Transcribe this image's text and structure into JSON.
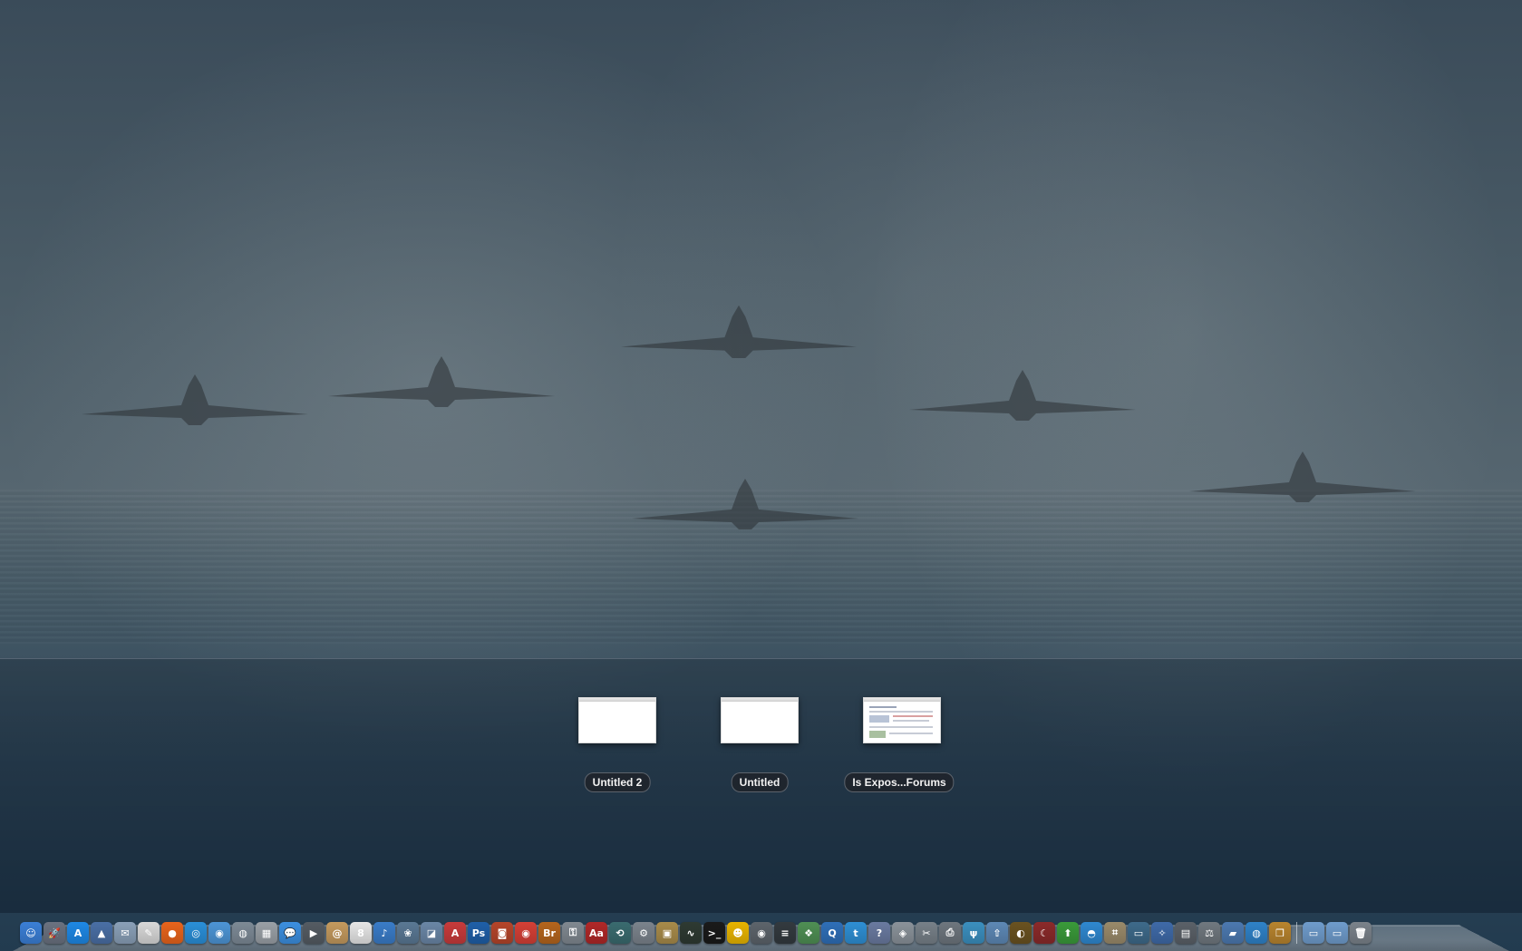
{
  "expose": {
    "windows": [
      {
        "title": "Untitled 2",
        "thumbnail": "blank-document"
      },
      {
        "title": "Untitled",
        "thumbnail": "blank-document"
      },
      {
        "title": "Is Expos...Forums",
        "thumbnail": "web-forum-page"
      }
    ]
  },
  "dock": {
    "apps": [
      {
        "icon": "finder-icon",
        "glyph": "☺",
        "color": "#3b7fd6"
      },
      {
        "icon": "launchpad-icon",
        "glyph": "🚀",
        "color": "#6b7280"
      },
      {
        "icon": "app-store-icon",
        "glyph": "A",
        "color": "#1e88e5"
      },
      {
        "icon": "preview-icon",
        "glyph": "▲",
        "color": "#4a6fa5"
      },
      {
        "icon": "mail-icon",
        "glyph": "✉",
        "color": "#8aa0b8"
      },
      {
        "icon": "textedit-icon",
        "glyph": "✎",
        "color": "#d8d8d8"
      },
      {
        "icon": "firefox-icon",
        "glyph": "●",
        "color": "#e8641c"
      },
      {
        "icon": "safari-icon",
        "glyph": "◎",
        "color": "#2a8fd8"
      },
      {
        "icon": "chrome-like-icon",
        "glyph": "◉",
        "color": "#4d95d6"
      },
      {
        "icon": "network-utility-icon",
        "glyph": "◍",
        "color": "#7d8a96"
      },
      {
        "icon": "calculator-icon",
        "glyph": "▦",
        "color": "#9aa0a6"
      },
      {
        "icon": "ichat-icon",
        "glyph": "💬",
        "color": "#3c8fe0"
      },
      {
        "icon": "facetime-icon",
        "glyph": "▶",
        "color": "#555c63"
      },
      {
        "icon": "address-book-icon",
        "glyph": "@",
        "color": "#c49a5e"
      },
      {
        "icon": "ical-icon",
        "glyph": "8",
        "color": "#e6e6e6"
      },
      {
        "icon": "itunes-icon",
        "glyph": "♪",
        "color": "#3a7cc8"
      },
      {
        "icon": "iphoto-icon",
        "glyph": "❀",
        "color": "#5a7894"
      },
      {
        "icon": "image-capture-icon",
        "glyph": "◪",
        "color": "#6a86a6"
      },
      {
        "icon": "acrobat-icon",
        "glyph": "A",
        "color": "#c83b3b"
      },
      {
        "icon": "photoshop-icon",
        "glyph": "Ps",
        "color": "#1f5fa8"
      },
      {
        "icon": "photo-booth-icon",
        "glyph": "◙",
        "color": "#b5452a"
      },
      {
        "icon": "google-chrome-icon",
        "glyph": "◉",
        "color": "#d54036"
      },
      {
        "icon": "bridge-icon",
        "glyph": "Br",
        "color": "#b5651d"
      },
      {
        "icon": "keychain-icon",
        "glyph": "⚿",
        "color": "#808890"
      },
      {
        "icon": "dictionary-icon",
        "glyph": "Aa",
        "color": "#b02828"
      },
      {
        "icon": "time-machine-icon",
        "glyph": "⟲",
        "color": "#3a6b6f"
      },
      {
        "icon": "system-preferences-icon",
        "glyph": "⚙",
        "color": "#7b838c"
      },
      {
        "icon": "migration-assistant-icon",
        "glyph": "▣",
        "color": "#a88b4a"
      },
      {
        "icon": "activity-monitor-icon",
        "glyph": "∿",
        "color": "#2e3a32"
      },
      {
        "icon": "terminal-icon",
        "glyph": ">_",
        "color": "#1a1a1a"
      },
      {
        "icon": "adium-icon",
        "glyph": "☻",
        "color": "#e8b400"
      },
      {
        "icon": "screenshot-icon",
        "glyph": "◉",
        "color": "#5d646b"
      },
      {
        "icon": "console-icon",
        "glyph": "≡",
        "color": "#333a3f"
      },
      {
        "icon": "iphoto-library-icon",
        "glyph": "❖",
        "color": "#4f8f54"
      },
      {
        "icon": "quicktime-icon",
        "glyph": "Q",
        "color": "#2f6fb8"
      },
      {
        "icon": "twitter-icon",
        "glyph": "t",
        "color": "#2e8fd4"
      },
      {
        "icon": "ipa-icon",
        "glyph": "?",
        "color": "#6a7aa0"
      },
      {
        "icon": "disk-utility-icon",
        "glyph": "◈",
        "color": "#8a929a"
      },
      {
        "icon": "tools-icon",
        "glyph": "✂",
        "color": "#778088"
      },
      {
        "icon": "printer-icon",
        "glyph": "⎙",
        "color": "#6e767e"
      },
      {
        "icon": "scissors-app-icon",
        "glyph": "ψ",
        "color": "#3b8fbf"
      },
      {
        "icon": "upload-icon",
        "glyph": "⇧",
        "color": "#5d88b5"
      },
      {
        "icon": "dashboard-icon",
        "glyph": "◐",
        "color": "#6a5220"
      },
      {
        "icon": "moon-icon",
        "glyph": "☾",
        "color": "#8b2a2a"
      },
      {
        "icon": "green-arrow-icon",
        "glyph": "⬆",
        "color": "#3a9a3a"
      },
      {
        "icon": "airport-icon",
        "glyph": "◓",
        "color": "#2f88d0"
      },
      {
        "icon": "grab-icon",
        "glyph": "⌗",
        "color": "#9a8a6a"
      },
      {
        "icon": "screen-sharing-icon",
        "glyph": "▭",
        "color": "#3e6a8a"
      },
      {
        "icon": "compass-icon",
        "glyph": "✧",
        "color": "#3f6aa8"
      },
      {
        "icon": "photo-icon",
        "glyph": "▤",
        "color": "#5b6168"
      },
      {
        "icon": "scale-icon",
        "glyph": "⚖",
        "color": "#70787f"
      },
      {
        "icon": "applications-stack-icon",
        "glyph": "▰",
        "color": "#4c79b0"
      },
      {
        "icon": "globe-icon",
        "glyph": "◍",
        "color": "#2f82c8"
      },
      {
        "icon": "photo-frame-icon",
        "glyph": "❒",
        "color": "#b8842e"
      }
    ],
    "stacks": [
      {
        "icon": "folder-icon",
        "glyph": "▭",
        "color": "#6f9ccc"
      },
      {
        "icon": "downloads-folder-icon",
        "glyph": "▭",
        "color": "#6f9ccc"
      },
      {
        "icon": "trash-icon",
        "glyph": "🗑",
        "color": "#7a828a"
      }
    ]
  }
}
